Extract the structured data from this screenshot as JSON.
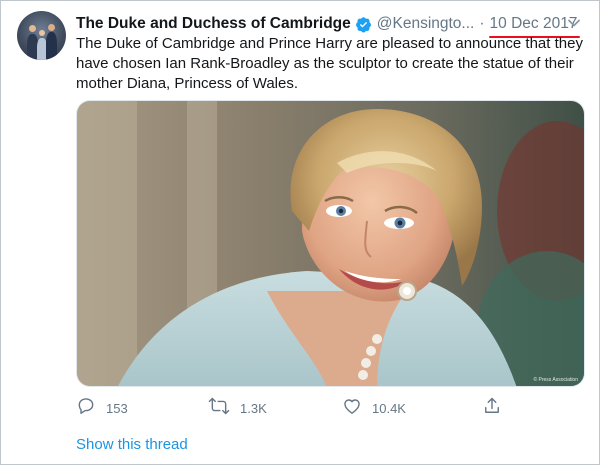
{
  "tweet": {
    "display_name": "The Duke and Duchess of Cambridge",
    "handle": "@Kensingto...",
    "separator": "·",
    "date": "10 Dec 2017",
    "text": "The Duke of Cambridge and Prince Harry are pleased to announce that they have chosen Ian Rank-Broadley as the sculptor to create the statue of their mother Diana, Princess of Wales.",
    "photo_credit": "© Press Association"
  },
  "actions": {
    "reply_count": "153",
    "retweet_count": "1.3K",
    "like_count": "10.4K"
  },
  "thread_link": "Show this thread",
  "colors": {
    "text": "#14171a",
    "secondary": "#657786",
    "link": "#1b95e0",
    "verified": "#1da1f2",
    "annotation_underline": "#e8101c"
  },
  "icons": {
    "verified": "verified-badge-icon",
    "caret": "chevron-down-icon",
    "reply": "reply-icon",
    "retweet": "retweet-icon",
    "like": "heart-icon",
    "share": "share-icon"
  }
}
